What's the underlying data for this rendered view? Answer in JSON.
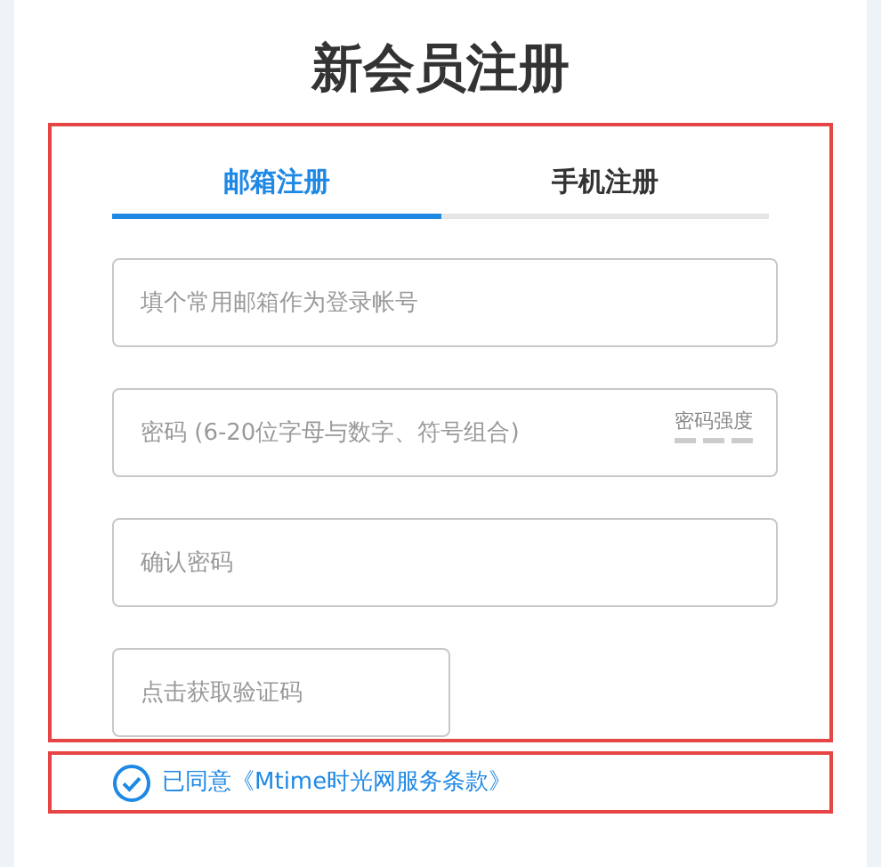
{
  "title": "新会员注册",
  "tabs": [
    {
      "label": "邮箱注册",
      "selected": true
    },
    {
      "label": "手机注册",
      "selected": false
    }
  ],
  "fields": [
    {
      "placeholder": "填个常用邮箱作为登录帐号",
      "kind": "text"
    },
    {
      "placeholder": "密码 (6-20位字母与数字、符号组合)",
      "kind": "password",
      "strength": {
        "label": "密码强度"
      }
    },
    {
      "placeholder": "确认密码",
      "kind": "text"
    },
    {
      "placeholder": "点击获取验证码",
      "kind": "code"
    }
  ],
  "agreement": {
    "checked": true,
    "label": "已同意《Mtime时光网服务条款》"
  }
}
